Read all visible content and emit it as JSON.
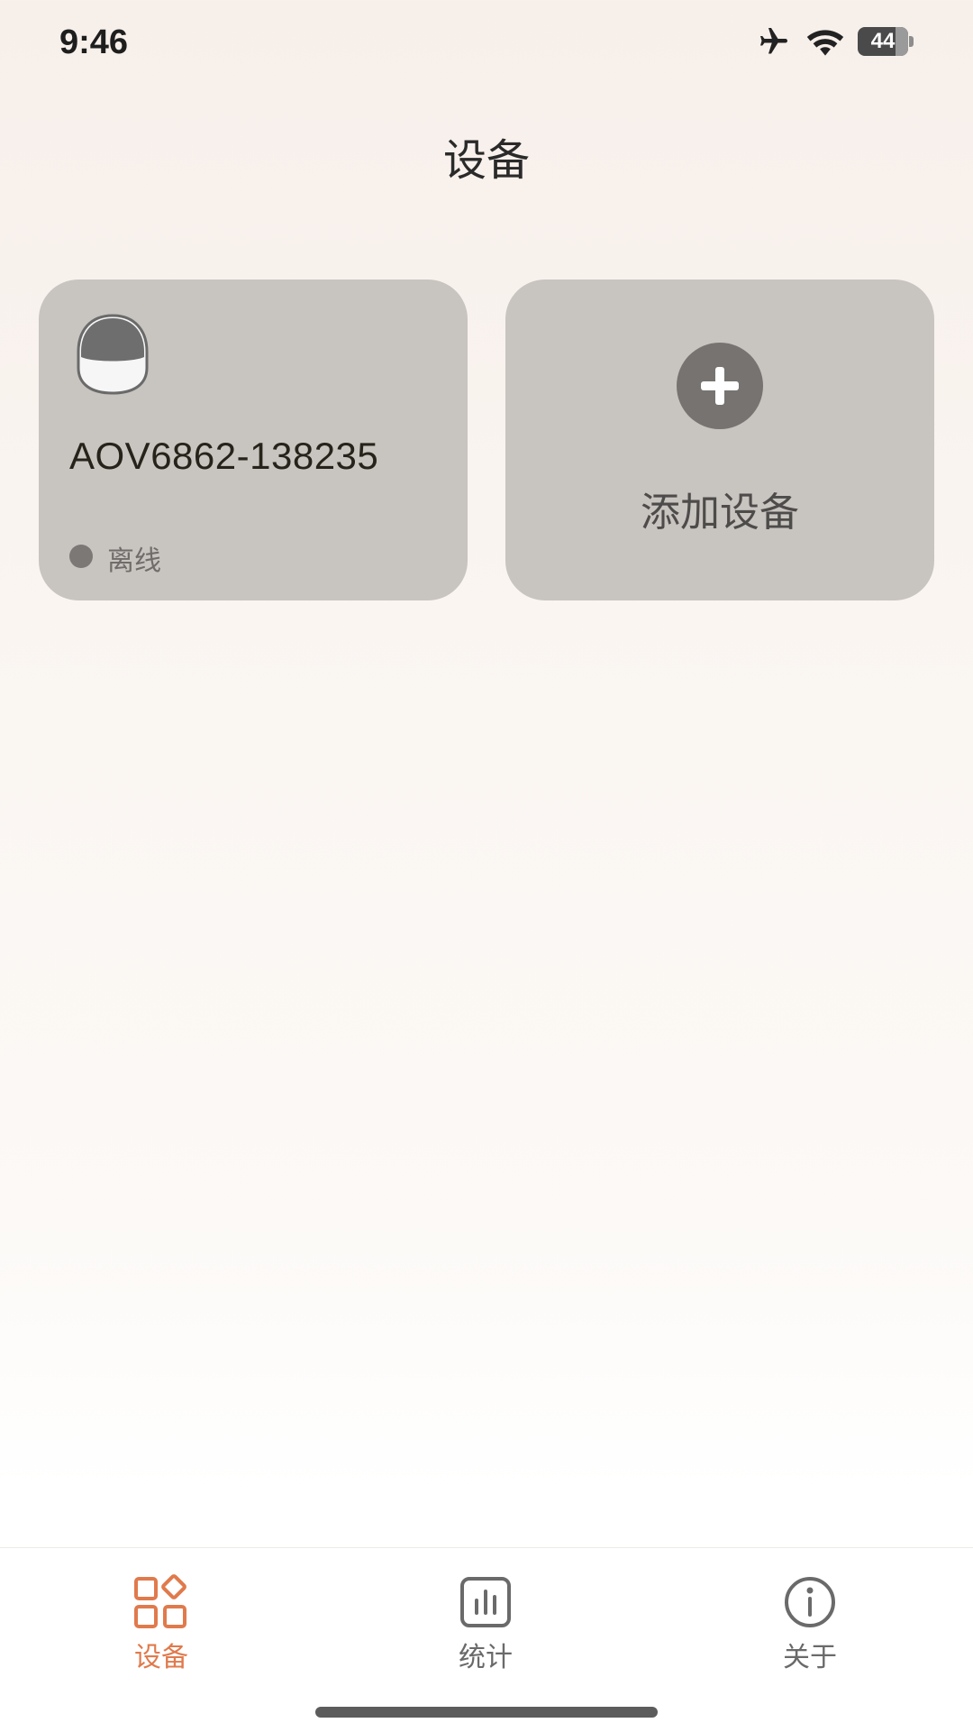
{
  "status_bar": {
    "time": "9:46",
    "battery_level": "44",
    "icons": [
      "airplane-icon",
      "wifi-icon",
      "battery-icon"
    ]
  },
  "page": {
    "title": "设备"
  },
  "devices": [
    {
      "name": "AOV6862-138235",
      "status": "离线",
      "status_color": "#7b7876",
      "icon": "camera-device-icon"
    }
  ],
  "add_device": {
    "label": "添加设备",
    "icon": "plus-icon"
  },
  "bottom_nav": {
    "items": [
      {
        "label": "设备",
        "icon": "grid-apps-icon",
        "active": true
      },
      {
        "label": "统计",
        "icon": "bar-chart-icon",
        "active": false
      },
      {
        "label": "关于",
        "icon": "info-icon",
        "active": false
      }
    ]
  },
  "colors": {
    "accent": "#e07a4c",
    "card_background": "#c8c4c0",
    "inactive_nav": "#6a6a6a"
  }
}
